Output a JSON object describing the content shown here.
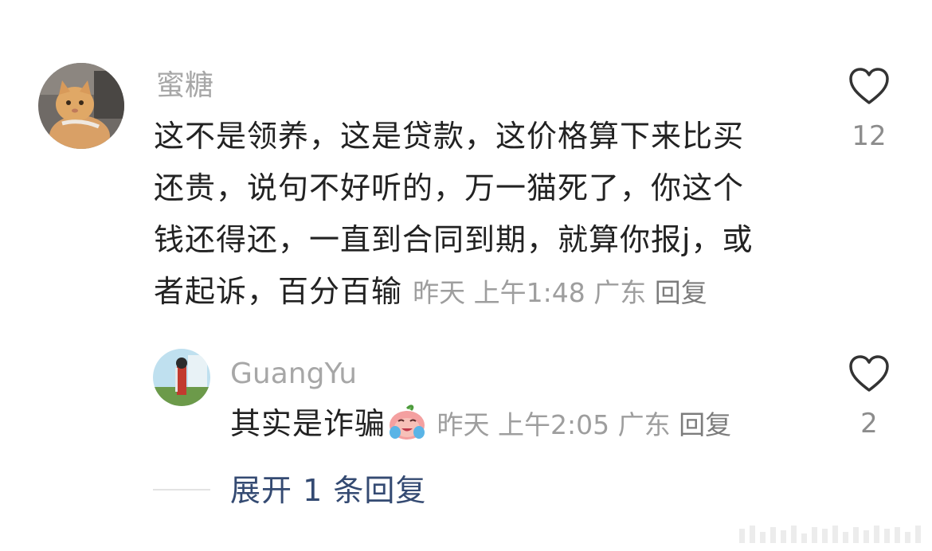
{
  "comment": {
    "username": "蜜糖",
    "content": "这不是领养，这是贷款，这价格算下来比买还贵，说句不好听的，万一猫死了，你这个钱还得还，一直到合同到期，就算你报j，或者起诉，百分百输",
    "lines": [
      "这不是领养，这是贷款，这价格算下来比买",
      "还贵，说句不好听的，万一猫死了，你这个",
      "钱还得还，一直到合同到期，就算你报j，或",
      "者起诉，百分百输"
    ],
    "time": "昨天 上午1:48",
    "location": "广东",
    "reply_label": "回复",
    "likes": "12"
  },
  "reply": {
    "username": "GuangYu",
    "content": "其实是诈骗",
    "emoji": "crying-face-emoji",
    "time": "昨天 上午2:05",
    "location": "广东",
    "reply_label": "回复",
    "likes": "2"
  },
  "expand_label": "展开 1 条回复"
}
